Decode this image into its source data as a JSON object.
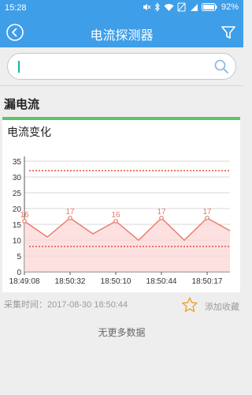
{
  "status_bar": {
    "time": "15:28",
    "battery": "92%"
  },
  "app_bar": {
    "title": "电流探测器"
  },
  "search": {
    "value": "",
    "placeholder": ""
  },
  "section": {
    "title": "漏电流"
  },
  "card": {
    "title": "电流变化"
  },
  "chart_data": {
    "type": "line",
    "title": "电流变化",
    "xlabel": "",
    "ylabel": "",
    "x": [
      0,
      0.5,
      1,
      1.5,
      2,
      2.5,
      3,
      3.5,
      4,
      4.5
    ],
    "tick_positions": [
      0,
      1,
      2,
      3,
      4
    ],
    "tick_labels": [
      "18:49:08",
      "18:50:32",
      "18:50:10",
      "18:50:44",
      "18:50:17"
    ],
    "values": [
      16,
      11,
      17,
      12,
      16,
      10,
      17,
      10,
      17,
      13
    ],
    "labeled_points": [
      {
        "index": 0,
        "label": "16"
      },
      {
        "index": 2,
        "label": "17"
      },
      {
        "index": 4,
        "label": "16"
      },
      {
        "index": 6,
        "label": "17"
      },
      {
        "index": 8,
        "label": "17"
      }
    ],
    "ylim": [
      0,
      35
    ],
    "yticks": [
      0,
      5,
      10,
      15,
      20,
      25,
      30,
      35
    ],
    "upper_limit": 32,
    "lower_limit": 8,
    "grid": true,
    "colors": {
      "line": "#e87a6a",
      "fill": "#fbd7d5",
      "limit": "#e0503a",
      "grid": "#d9d9d9"
    }
  },
  "footer": {
    "collect_time": "采集时间：2017-08-30 18:50:44",
    "favorite_label": "添加收藏",
    "no_more": "无更多数据"
  },
  "icons": {
    "back": "back-circle-icon",
    "filter": "filter-icon",
    "search": "search-icon",
    "favorite": "star-outline-icon"
  },
  "colors": {
    "primary": "#3f9ee8",
    "card_accent": "#5cc46a",
    "star": "#f0a030"
  }
}
